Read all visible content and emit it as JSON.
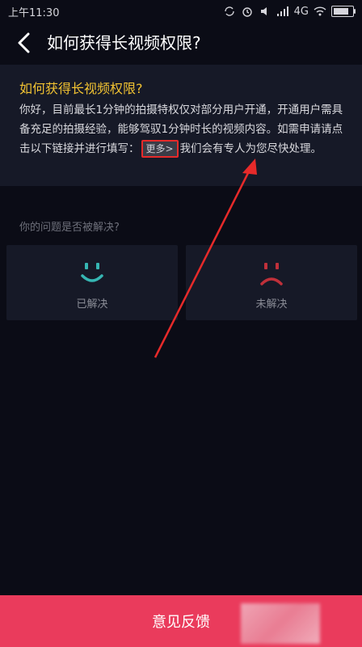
{
  "status_bar": {
    "time": "上午11:30",
    "network": "4G"
  },
  "header": {
    "title": "如何获得长视频权限?"
  },
  "card": {
    "title": "如何获得长视频权限?",
    "text_before_link": "你好，目前最长1分钟的拍摄特权仅对部分用户开通，开通用户需具备充足的拍摄经验，能够驾驭1分钟时长的视频内容。如需申请请点击以下链接并进行填写：",
    "more_link_label": "更多>",
    "text_after_link": "我们会有专人为您尽快处理。"
  },
  "question": {
    "label": "你的问题是否被解决?"
  },
  "choices": [
    {
      "label": "已解决",
      "icon": "smile-face-icon",
      "color": "#36b6b3"
    },
    {
      "label": "未解决",
      "icon": "sad-face-icon",
      "color": "#c0303a"
    }
  ],
  "feedback_button": {
    "label": "意见反馈"
  },
  "colors": {
    "accent": "#ea3b5c",
    "title_yellow": "#f1c232",
    "highlight_red": "#e62a2a"
  }
}
